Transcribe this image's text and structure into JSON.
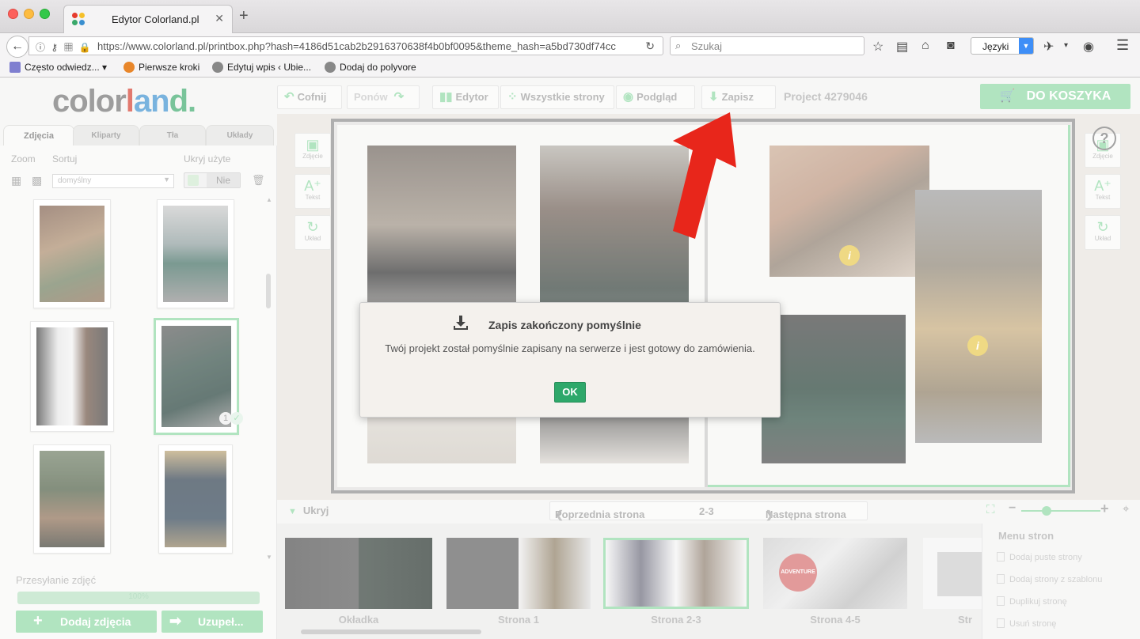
{
  "browser": {
    "tab_title": "Edytor Colorland.pl",
    "tab_close": "✕",
    "new_tab": "+",
    "url": "https://www.colorland.pl/printbox.php?hash=4186d51cab2b2916370638f4b0bf0095&theme_hash=a5bd730df74cc",
    "search_placeholder": "Szukaj",
    "language_select": "Języki",
    "bookmarks": [
      {
        "label": "Często odwiedz...",
        "icon": "folder-icon",
        "has_dropdown": true
      },
      {
        "label": "Pierwsze kroki",
        "icon": "firefox-icon"
      },
      {
        "label": "Edytuj wpis ‹ Ubie...",
        "icon": "globe-icon"
      },
      {
        "label": "Dodaj do polyvore",
        "icon": "globe-icon"
      }
    ]
  },
  "app": {
    "logo": {
      "part1": "color",
      "part2": "l",
      "part3": "an",
      "part4": "d."
    },
    "left_tabs": [
      "Zdjęcia",
      "Kliparty",
      "Tła",
      "Układy"
    ],
    "zoom_label": "Zoom",
    "sort_label": "Sortuj",
    "hide_used_label": "Ukryj użyte",
    "sort_value": "domyślny",
    "hide_used_value": "Nie",
    "photo_used_count": "1",
    "upload_label": "Przesyłanie zdjęć",
    "upload_progress_text": "100%",
    "upload_progress": 100,
    "add_photos_button": "Dodaj zdjęcia",
    "fill_button": "Uzupeł...",
    "toolbar": {
      "undo": "Cofnij",
      "redo": "Ponów",
      "editor": "Edytor",
      "all_pages": "Wszystkie strony",
      "preview": "Podgląd",
      "save": "Zapisz",
      "project": "Project 4279046",
      "cart": "DO KOSZYKA"
    },
    "side_tools": [
      "Zdjęcie",
      "Tekst",
      "Układ"
    ],
    "info_badge": "i",
    "help": "?",
    "bottom": {
      "hide": "Ukryj",
      "prev_page": "Poprzednia strona",
      "page_range": "2-3",
      "next_page": "Następna strona",
      "zoom_minus": "−",
      "zoom_plus": "+"
    },
    "film_pages": [
      "Okładka",
      "Strona 1",
      "Strona 2-3",
      "Strona 4-5",
      "Str"
    ],
    "adventure_badge": "ADVENTURE",
    "page_menu": {
      "title": "Menu stron",
      "items": [
        "Dodaj puste strony",
        "Dodaj strony z szablonu",
        "Duplikuj stronę",
        "Usuń stronę"
      ]
    }
  },
  "modal": {
    "title": "Zapis zakończony pomyślnie",
    "message": "Twój projekt został pomyślnie zapisany na serwerze i jest gotowy do zamówienia.",
    "ok": "OK"
  },
  "colors": {
    "accent_green": "#8cd7a3",
    "ok_green": "#2ea86a",
    "arrow_red": "#e8261b"
  }
}
